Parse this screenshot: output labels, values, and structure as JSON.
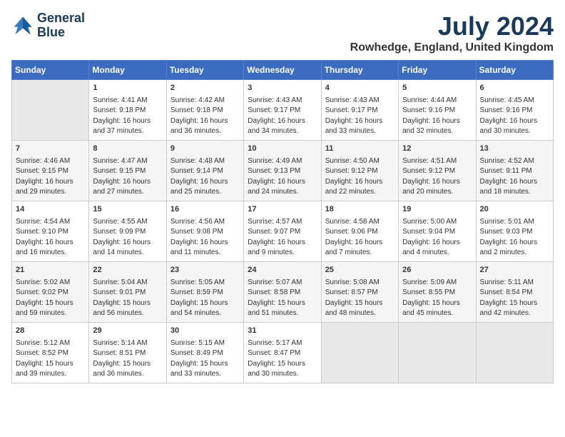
{
  "header": {
    "logo_line1": "General",
    "logo_line2": "Blue",
    "month_year": "July 2024",
    "location": "Rowhedge, England, United Kingdom"
  },
  "days_of_week": [
    "Sunday",
    "Monday",
    "Tuesday",
    "Wednesday",
    "Thursday",
    "Friday",
    "Saturday"
  ],
  "weeks": [
    [
      {
        "day": "",
        "sunrise": "",
        "sunset": "",
        "daylight": ""
      },
      {
        "day": "1",
        "sunrise": "Sunrise: 4:41 AM",
        "sunset": "Sunset: 9:18 PM",
        "daylight": "Daylight: 16 hours and 37 minutes."
      },
      {
        "day": "2",
        "sunrise": "Sunrise: 4:42 AM",
        "sunset": "Sunset: 9:18 PM",
        "daylight": "Daylight: 16 hours and 36 minutes."
      },
      {
        "day": "3",
        "sunrise": "Sunrise: 4:43 AM",
        "sunset": "Sunset: 9:17 PM",
        "daylight": "Daylight: 16 hours and 34 minutes."
      },
      {
        "day": "4",
        "sunrise": "Sunrise: 4:43 AM",
        "sunset": "Sunset: 9:17 PM",
        "daylight": "Daylight: 16 hours and 33 minutes."
      },
      {
        "day": "5",
        "sunrise": "Sunrise: 4:44 AM",
        "sunset": "Sunset: 9:16 PM",
        "daylight": "Daylight: 16 hours and 32 minutes."
      },
      {
        "day": "6",
        "sunrise": "Sunrise: 4:45 AM",
        "sunset": "Sunset: 9:16 PM",
        "daylight": "Daylight: 16 hours and 30 minutes."
      }
    ],
    [
      {
        "day": "7",
        "sunrise": "Sunrise: 4:46 AM",
        "sunset": "Sunset: 9:15 PM",
        "daylight": "Daylight: 16 hours and 29 minutes."
      },
      {
        "day": "8",
        "sunrise": "Sunrise: 4:47 AM",
        "sunset": "Sunset: 9:15 PM",
        "daylight": "Daylight: 16 hours and 27 minutes."
      },
      {
        "day": "9",
        "sunrise": "Sunrise: 4:48 AM",
        "sunset": "Sunset: 9:14 PM",
        "daylight": "Daylight: 16 hours and 25 minutes."
      },
      {
        "day": "10",
        "sunrise": "Sunrise: 4:49 AM",
        "sunset": "Sunset: 9:13 PM",
        "daylight": "Daylight: 16 hours and 24 minutes."
      },
      {
        "day": "11",
        "sunrise": "Sunrise: 4:50 AM",
        "sunset": "Sunset: 9:12 PM",
        "daylight": "Daylight: 16 hours and 22 minutes."
      },
      {
        "day": "12",
        "sunrise": "Sunrise: 4:51 AM",
        "sunset": "Sunset: 9:12 PM",
        "daylight": "Daylight: 16 hours and 20 minutes."
      },
      {
        "day": "13",
        "sunrise": "Sunrise: 4:52 AM",
        "sunset": "Sunset: 9:11 PM",
        "daylight": "Daylight: 16 hours and 18 minutes."
      }
    ],
    [
      {
        "day": "14",
        "sunrise": "Sunrise: 4:54 AM",
        "sunset": "Sunset: 9:10 PM",
        "daylight": "Daylight: 16 hours and 16 minutes."
      },
      {
        "day": "15",
        "sunrise": "Sunrise: 4:55 AM",
        "sunset": "Sunset: 9:09 PM",
        "daylight": "Daylight: 16 hours and 14 minutes."
      },
      {
        "day": "16",
        "sunrise": "Sunrise: 4:56 AM",
        "sunset": "Sunset: 9:08 PM",
        "daylight": "Daylight: 16 hours and 11 minutes."
      },
      {
        "day": "17",
        "sunrise": "Sunrise: 4:57 AM",
        "sunset": "Sunset: 9:07 PM",
        "daylight": "Daylight: 16 hours and 9 minutes."
      },
      {
        "day": "18",
        "sunrise": "Sunrise: 4:58 AM",
        "sunset": "Sunset: 9:06 PM",
        "daylight": "Daylight: 16 hours and 7 minutes."
      },
      {
        "day": "19",
        "sunrise": "Sunrise: 5:00 AM",
        "sunset": "Sunset: 9:04 PM",
        "daylight": "Daylight: 16 hours and 4 minutes."
      },
      {
        "day": "20",
        "sunrise": "Sunrise: 5:01 AM",
        "sunset": "Sunset: 9:03 PM",
        "daylight": "Daylight: 16 hours and 2 minutes."
      }
    ],
    [
      {
        "day": "21",
        "sunrise": "Sunrise: 5:02 AM",
        "sunset": "Sunset: 9:02 PM",
        "daylight": "Daylight: 15 hours and 59 minutes."
      },
      {
        "day": "22",
        "sunrise": "Sunrise: 5:04 AM",
        "sunset": "Sunset: 9:01 PM",
        "daylight": "Daylight: 15 hours and 56 minutes."
      },
      {
        "day": "23",
        "sunrise": "Sunrise: 5:05 AM",
        "sunset": "Sunset: 8:59 PM",
        "daylight": "Daylight: 15 hours and 54 minutes."
      },
      {
        "day": "24",
        "sunrise": "Sunrise: 5:07 AM",
        "sunset": "Sunset: 8:58 PM",
        "daylight": "Daylight: 15 hours and 51 minutes."
      },
      {
        "day": "25",
        "sunrise": "Sunrise: 5:08 AM",
        "sunset": "Sunset: 8:57 PM",
        "daylight": "Daylight: 15 hours and 48 minutes."
      },
      {
        "day": "26",
        "sunrise": "Sunrise: 5:09 AM",
        "sunset": "Sunset: 8:55 PM",
        "daylight": "Daylight: 15 hours and 45 minutes."
      },
      {
        "day": "27",
        "sunrise": "Sunrise: 5:11 AM",
        "sunset": "Sunset: 8:54 PM",
        "daylight": "Daylight: 15 hours and 42 minutes."
      }
    ],
    [
      {
        "day": "28",
        "sunrise": "Sunrise: 5:12 AM",
        "sunset": "Sunset: 8:52 PM",
        "daylight": "Daylight: 15 hours and 39 minutes."
      },
      {
        "day": "29",
        "sunrise": "Sunrise: 5:14 AM",
        "sunset": "Sunset: 8:51 PM",
        "daylight": "Daylight: 15 hours and 36 minutes."
      },
      {
        "day": "30",
        "sunrise": "Sunrise: 5:15 AM",
        "sunset": "Sunset: 8:49 PM",
        "daylight": "Daylight: 15 hours and 33 minutes."
      },
      {
        "day": "31",
        "sunrise": "Sunrise: 5:17 AM",
        "sunset": "Sunset: 8:47 PM",
        "daylight": "Daylight: 15 hours and 30 minutes."
      },
      {
        "day": "",
        "sunrise": "",
        "sunset": "",
        "daylight": ""
      },
      {
        "day": "",
        "sunrise": "",
        "sunset": "",
        "daylight": ""
      },
      {
        "day": "",
        "sunrise": "",
        "sunset": "",
        "daylight": ""
      }
    ]
  ]
}
